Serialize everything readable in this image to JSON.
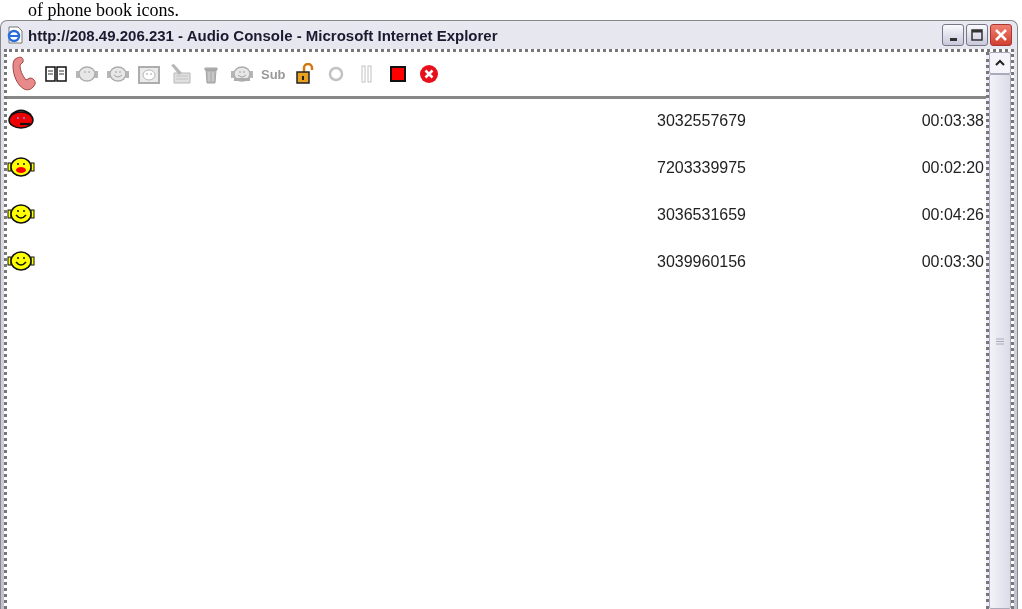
{
  "caption": "of phone book icons.",
  "window": {
    "title": "http://208.49.206.231 - Audio Console - Microsoft Internet Explorer"
  },
  "toolbar": [
    {
      "kind": "phone",
      "disabled": false
    },
    {
      "kind": "book",
      "disabled": false
    },
    {
      "kind": "face-plain",
      "disabled": true
    },
    {
      "kind": "face-smile",
      "disabled": true
    },
    {
      "kind": "face-box",
      "disabled": true
    },
    {
      "kind": "notepad",
      "disabled": true
    },
    {
      "kind": "trash",
      "disabled": true
    },
    {
      "kind": "face-phone",
      "disabled": true
    },
    {
      "kind": "sub",
      "label": "Sub",
      "disabled": true
    },
    {
      "kind": "lock",
      "disabled": false
    },
    {
      "kind": "record",
      "disabled": true
    },
    {
      "kind": "pause",
      "disabled": true
    },
    {
      "kind": "stop",
      "disabled": false
    },
    {
      "kind": "cancel",
      "disabled": false
    }
  ],
  "calls": [
    {
      "kind": "talking",
      "number": "3032557679",
      "duration": "00:03:38"
    },
    {
      "kind": "speaking",
      "number": "7203339975",
      "duration": "00:02:20"
    },
    {
      "kind": "listening",
      "number": "3036531659",
      "duration": "00:04:26"
    },
    {
      "kind": "listening",
      "number": "3039960156",
      "duration": "00:03:30"
    }
  ]
}
